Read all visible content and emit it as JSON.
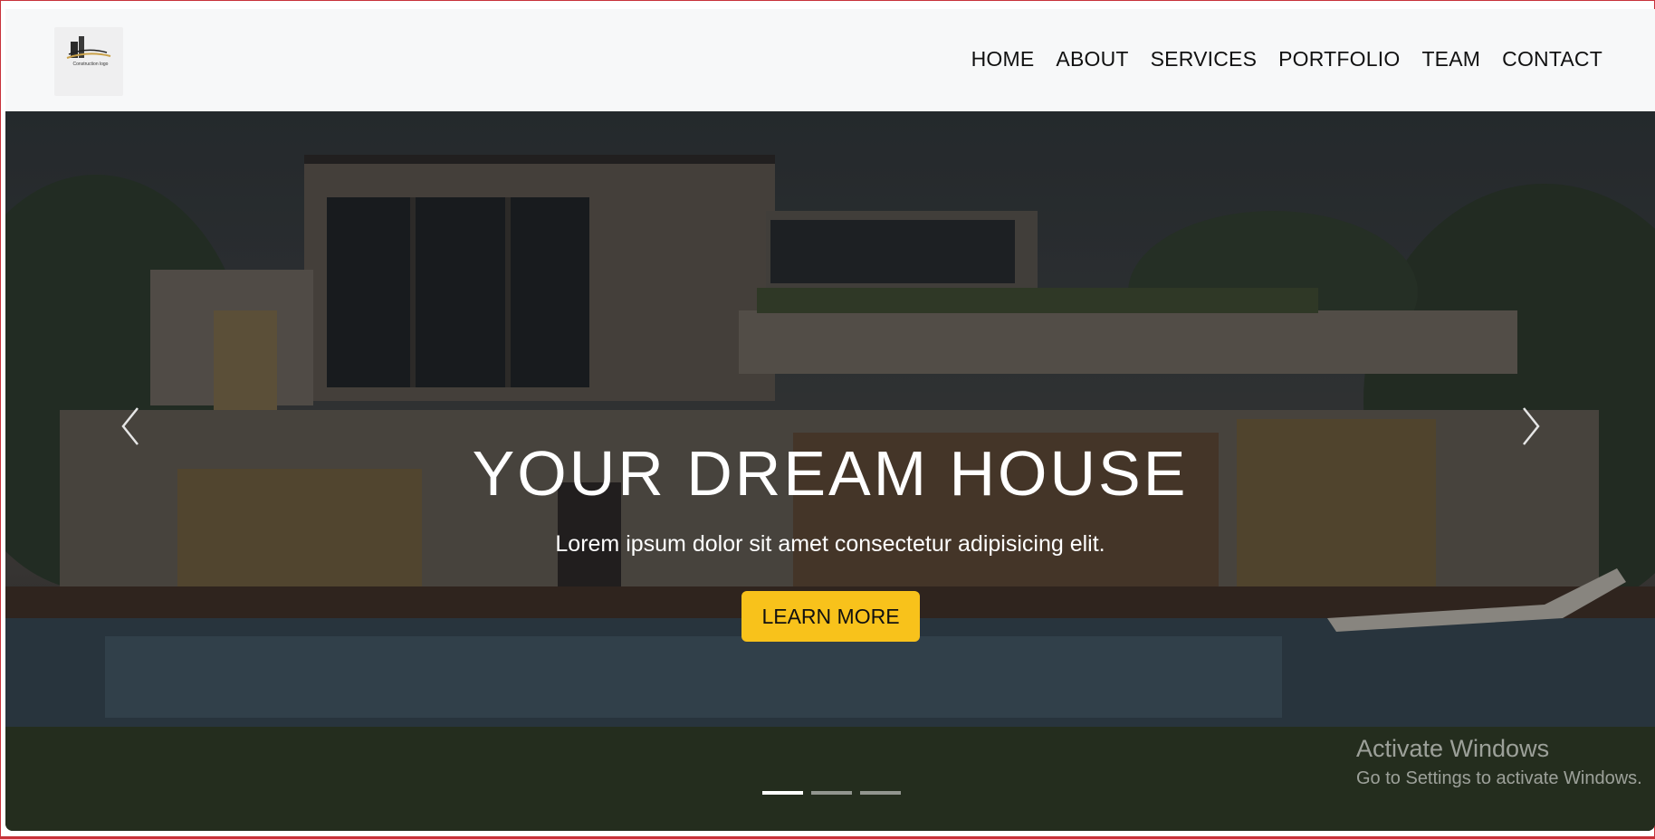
{
  "brand": {
    "logo_text": "Construction logo"
  },
  "nav": {
    "items": [
      {
        "label": "HOME"
      },
      {
        "label": "ABOUT"
      },
      {
        "label": "SERVICES"
      },
      {
        "label": "PORTFOLIO"
      },
      {
        "label": "TEAM"
      },
      {
        "label": "CONTACT"
      }
    ]
  },
  "hero": {
    "title": "YOUR DREAM HOUSE",
    "subtitle": "Lorem ipsum dolor sit amet consectetur adipisicing elit.",
    "cta_label": "LEARN MORE",
    "slides_total": 3,
    "active_slide": 1
  },
  "watermark": {
    "title": "Activate Windows",
    "subtitle": "Go to Settings to activate Windows."
  },
  "colors": {
    "accent": "#f8c21b",
    "navbar_bg": "#f7f8f9",
    "frame_border": "#c8323a"
  },
  "icons": [
    "chevron-left-icon",
    "chevron-right-icon",
    "logo-icon"
  ]
}
